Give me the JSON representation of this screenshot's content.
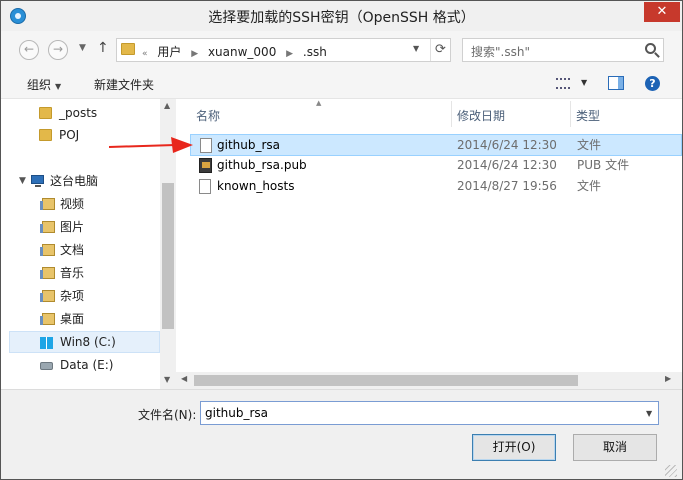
{
  "window": {
    "title": "选择要加载的SSH密钥（OpenSSH 格式）",
    "close_glyph": "✕"
  },
  "nav": {
    "back_glyph": "←",
    "forward_glyph": "→",
    "up_glyph": "↑",
    "breadcrumbs": [
      "«",
      "用户",
      "xuanw_000",
      ".ssh"
    ],
    "search_placeholder": "搜索\".ssh\""
  },
  "toolbar": {
    "organize_label": "组织",
    "new_folder_label": "新建文件夹",
    "help_glyph": "?"
  },
  "sidebar": {
    "items": [
      {
        "label": "_posts",
        "icon": "folder-icon"
      },
      {
        "label": "POJ",
        "icon": "folder-icon"
      },
      {
        "label": "这台电脑",
        "icon": "computer-icon"
      },
      {
        "label": "视频",
        "icon": "video-library-icon"
      },
      {
        "label": "图片",
        "icon": "pictures-library-icon"
      },
      {
        "label": "文档",
        "icon": "documents-library-icon"
      },
      {
        "label": "音乐",
        "icon": "music-library-icon"
      },
      {
        "label": "杂项",
        "icon": "downloads-library-icon"
      },
      {
        "label": "桌面",
        "icon": "desktop-folder-icon"
      },
      {
        "label": "Win8 (C:)",
        "icon": "windows-drive-icon"
      },
      {
        "label": "Data (E:)",
        "icon": "drive-icon"
      }
    ]
  },
  "file_list": {
    "columns": [
      "名称",
      "修改日期",
      "类型"
    ],
    "rows": [
      {
        "name": "github_rsa",
        "date": "2014/6/24 12:30",
        "type": "文件"
      },
      {
        "name": "github_rsa.pub",
        "date": "2014/6/24 12:30",
        "type": "PUB 文件"
      },
      {
        "name": "known_hosts",
        "date": "2014/8/27 19:56",
        "type": "文件"
      }
    ]
  },
  "footer": {
    "filename_label": "文件名(N):",
    "filename_value": "github_rsa",
    "open_label": "打开(O)",
    "cancel_label": "取消"
  },
  "colors": {
    "selection": "#cce8ff",
    "annotation_arrow": "#e8271c",
    "close_button": "#c7392c"
  }
}
